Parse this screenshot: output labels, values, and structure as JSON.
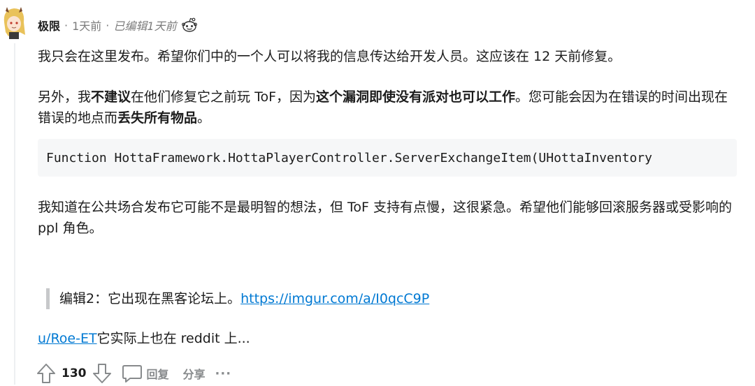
{
  "comment": {
    "author": "极限",
    "separator": "·",
    "time": "1天前",
    "edited": "已编辑1天前",
    "paragraphs": {
      "p1": "我只会在这里发布。希望你们中的一个人可以将我的信息传达给开发人员。这应该在 12 天前修复。",
      "p2": {
        "a": "另外，我",
        "b": "不建议",
        "c": "在他们修复它之前玩 ToF，因为",
        "d": "这个漏洞即使没有派对也可以工作",
        "e": "。您可能会因为在错误的时间出现在错误的地点而",
        "f": "丢失所有物品",
        "g": "。"
      },
      "code": "Function HottaFramework.HottaPlayerController.ServerExchangeItem(UHottaInventory",
      "p3": "我知道在公共场合发布它可能不是最明智的想法，但 ToF 支持有点慢，这很紧急。希望他们能够回滚服务器或受影响的 ppl 角色。",
      "quote": {
        "text": "编辑2：它出现在黑客论坛上。",
        "link": "https://imgur.com/a/I0qcC9P"
      },
      "mention": {
        "user": "u/Roe-ET",
        "text": "它实际上也在 reddit 上..."
      }
    },
    "footer": {
      "votes": "130",
      "reply": "回复",
      "share": "分享",
      "more": "···"
    }
  },
  "colors": {
    "link": "#0079d3",
    "meta": "#7c7c7c",
    "action": "#878a8c",
    "code_bg": "#f6f7f8"
  }
}
